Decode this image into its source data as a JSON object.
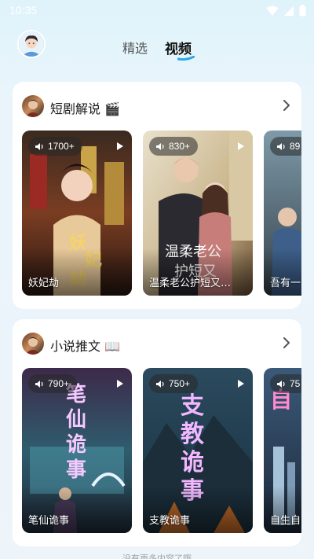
{
  "status": {
    "time": "10:35"
  },
  "header": {
    "tabs": [
      {
        "label": "精选",
        "active": false
      },
      {
        "label": "视频",
        "active": true
      }
    ],
    "accent_color": "#2aa8e8"
  },
  "sections": [
    {
      "title": "短剧解说 🎬",
      "items": [
        {
          "count": "1700+",
          "title": "妖妃劫"
        },
        {
          "count": "830+",
          "title": "温柔老公护短又…"
        },
        {
          "count": "89",
          "title": "吾有一…"
        }
      ]
    },
    {
      "title": "小说推文 📖",
      "items": [
        {
          "count": "790+",
          "title": "笔仙诡事"
        },
        {
          "count": "750+",
          "title": "支教诡事"
        },
        {
          "count": "75",
          "title": "自生自…"
        }
      ]
    }
  ],
  "footer": {
    "hint": "没有更多内容了哦"
  }
}
